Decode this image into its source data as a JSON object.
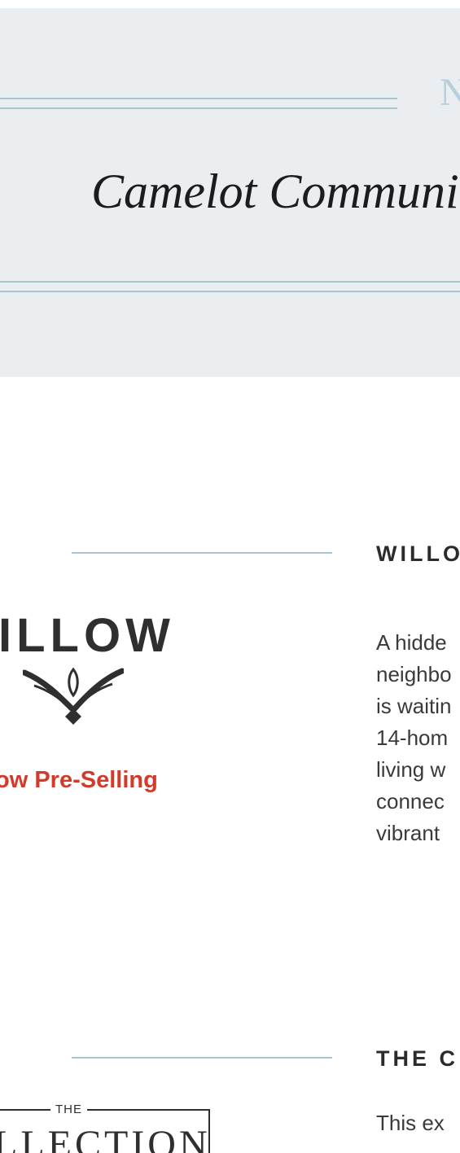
{
  "hero": {
    "overline": "N",
    "headline": "Camelot Communi"
  },
  "sections": [
    {
      "title": "WILLO",
      "logo_wordmark": "ILLOW",
      "status": "ow Pre-Selling",
      "description": [
        "A hidde",
        "neighbo",
        "is waitin",
        "14-hom",
        "living w",
        "connec",
        "vibrant"
      ]
    },
    {
      "title": "THE C",
      "logo_top": "THE",
      "logo_wordmark": "LLECTION",
      "description": [
        "This ex"
      ]
    }
  ],
  "colors": {
    "hero_background": "#eaeef1",
    "rule": "#a9c5d3",
    "accent_red": "#d23b2a",
    "text_dark": "#2b2b2b"
  },
  "icons": [
    "willow-emblem-icon"
  ]
}
